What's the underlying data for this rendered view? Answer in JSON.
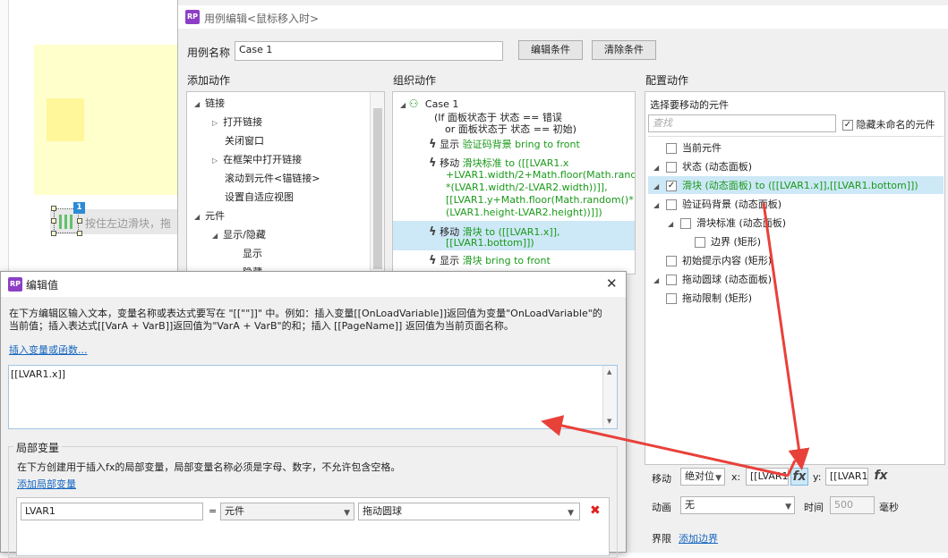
{
  "canvas": {
    "slider_hint": "按住左边滑块，拖",
    "badge": "1"
  },
  "dialog": {
    "title": "用例编辑<鼠标移入时>",
    "case_name_label": "用例名称",
    "case_name_value": "Case 1",
    "edit_condition_btn": "编辑条件",
    "clear_condition_btn": "清除条件",
    "col_add_action": "添加动作",
    "col_organize": "组织动作",
    "col_config": "配置动作",
    "add_actions": [
      {
        "label": "链接",
        "level": 0,
        "exp": "down"
      },
      {
        "label": "打开链接",
        "level": 1,
        "exp": "right"
      },
      {
        "label": "关闭窗口",
        "level": 1,
        "exp": ""
      },
      {
        "label": "在框架中打开链接",
        "level": 1,
        "exp": "right"
      },
      {
        "label": "滚动到元件<锚链接>",
        "level": 1,
        "exp": ""
      },
      {
        "label": "设置自适应视图",
        "level": 1,
        "exp": ""
      },
      {
        "label": "元件",
        "level": 0,
        "exp": "down"
      },
      {
        "label": "显示/隐藏",
        "level": 1,
        "exp": "down"
      },
      {
        "label": "显示",
        "level": 2,
        "exp": ""
      },
      {
        "label": "隐藏",
        "level": 2,
        "exp": ""
      }
    ],
    "organize": {
      "case_title": "Case 1",
      "case_cond1": "(If 面板状态于 状态 == 错误",
      "case_cond2": "or 面板状态于 状态 == 初始)",
      "a1_verb": "显示",
      "a1_rest": "验证码背景 bring to front",
      "a2_verb": "移动",
      "a2_l1": "滑块标准 to ([[LVAR1.x",
      "a2_l2": "+LVAR1.width/2+Math.floor(Math.random()",
      "a2_l3": "*(LVAR1.width/2-LVAR2.width))]],",
      "a2_l4": "[[LVAR1.y+Math.floor(Math.random()*",
      "a2_l5": "(LVAR1.height-LVAR2.height))]])",
      "a3_verb": "移动",
      "a3_l1": "滑块 to ([[LVAR1.x]],",
      "a3_l2": "[[LVAR1.bottom]])",
      "a4_verb": "显示",
      "a4_rest": "滑块 bring to front"
    },
    "config": {
      "select_label": "选择要移动的元件",
      "search_placeholder": "查找",
      "hide_unnamed": "隐藏未命名的元件",
      "items": [
        {
          "label": "当前元件",
          "tri": "",
          "indent": 0,
          "checked": false,
          "sel": false
        },
        {
          "label": "状态 (动态面板)",
          "tri": "◢",
          "indent": 0,
          "checked": false,
          "sel": false
        },
        {
          "label": "滑块 (动态面板) to ([[LVAR1.x]],[[LVAR1.bottom]])",
          "tri": "◢",
          "indent": 0,
          "checked": true,
          "sel": true
        },
        {
          "label": "验证码背景 (动态面板)",
          "tri": "◢",
          "indent": 0,
          "checked": false,
          "sel": false
        },
        {
          "label": "滑块标准 (动态面板)",
          "tri": "◢",
          "indent": 1,
          "checked": false,
          "sel": false
        },
        {
          "label": "边界 (矩形)",
          "tri": "",
          "indent": 2,
          "checked": false,
          "sel": false
        },
        {
          "label": "初始提示内容 (矩形)",
          "tri": "",
          "indent": 0,
          "checked": false,
          "sel": false
        },
        {
          "label": "拖动圆球 (动态面板)",
          "tri": "◢",
          "indent": 0,
          "checked": false,
          "sel": false
        },
        {
          "label": "拖动限制 (矩形)",
          "tri": "",
          "indent": 0,
          "checked": false,
          "sel": false
        }
      ],
      "move_label": "移动",
      "move_mode": "绝对位",
      "x_label": "x:",
      "x_value": "[[LVAR1.",
      "y_label": "y:",
      "y_value": "[[LVAR1.",
      "fx": "fx",
      "anim_label": "动画",
      "anim_value": "无",
      "time_label": "时间",
      "time_value": "500",
      "ms_label": "毫秒",
      "bounds_label": "界限",
      "add_bounds": "添加边界"
    }
  },
  "edit_value": {
    "title": "编辑值",
    "close": "✕",
    "desc1": "在下方编辑区输入文本，变量名称或表达式要写在 \"[[\"\"]]\" 中。例如：插入变量[[OnLoadVariable]]返回值为变量\"OnLoadVariable\"的",
    "desc2": "当前值；插入表达式[[VarA + VarB]]返回值为\"VarA + VarB\"的和；插入 [[PageName]] 返回值为当前页面名称。",
    "insert_link": "插入变量或函数...",
    "editor_value": "[[LVAR1.x]]",
    "local_vars_title": "局部变量",
    "local_vars_desc": "在下方创建用于插入fx的局部变量，局部变量名称必须是字母、数字，不允许包含空格。",
    "add_local_var": "添加局部变量",
    "var_name": "LVAR1",
    "eq": "=",
    "var_type": "元件",
    "var_target": "拖动圆球",
    "delete": "✖"
  },
  "colors": {
    "arrow": "#e8413a",
    "selection": "#cde8f7",
    "link": "#1566c0",
    "green_text": "#1a9a1a"
  }
}
